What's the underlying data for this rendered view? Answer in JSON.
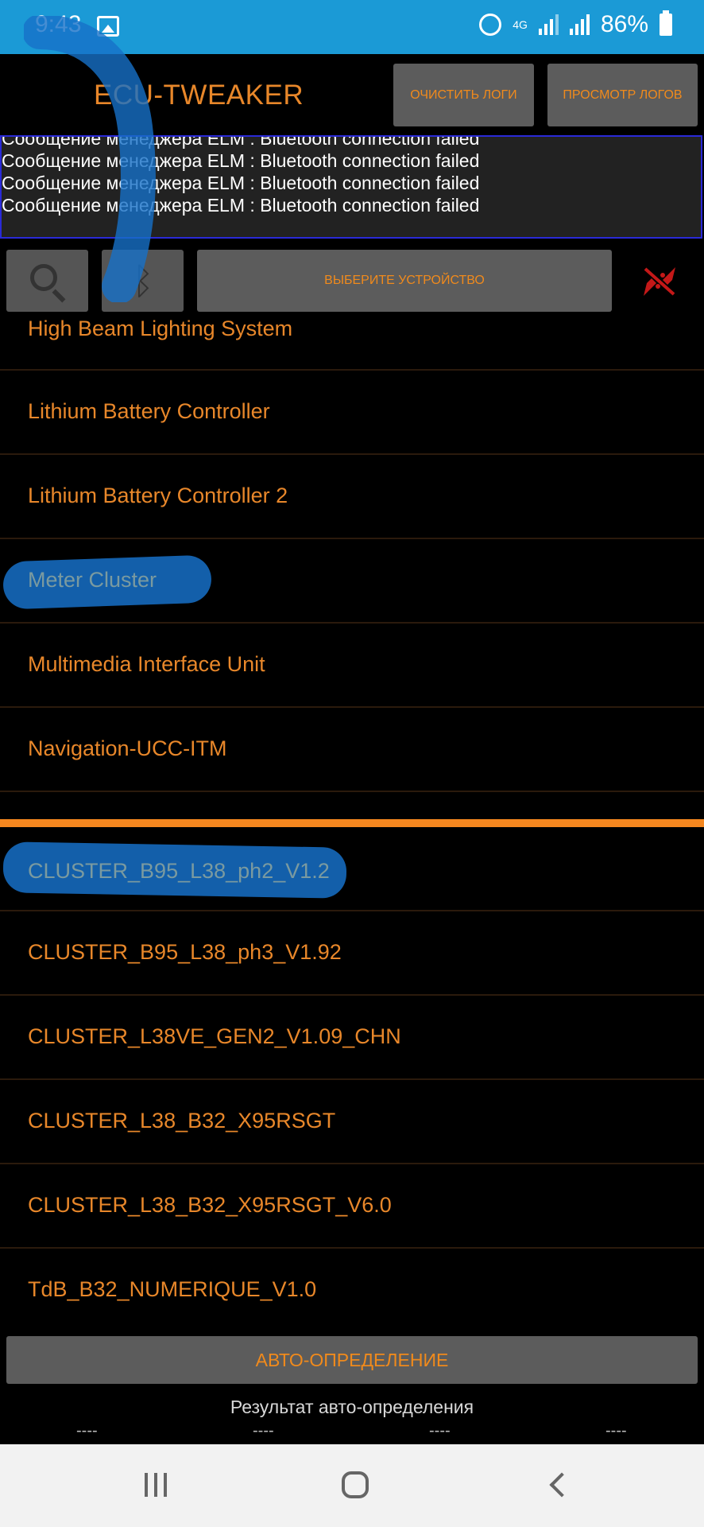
{
  "status_bar": {
    "time": "9:43",
    "network": "4G",
    "battery": "86%"
  },
  "app": {
    "title": "ECU-TWEAKER",
    "clear_logs_label": "ОЧИСТИТЬ ЛОГИ",
    "view_logs_label": "ПРОСМОТР ЛОГОВ"
  },
  "log": {
    "lines": [
      "Сообщение менеджера ELM : Bluetooth connection failed",
      "Сообщение менеджера ELM : Bluetooth connection failed",
      "Сообщение менеджера ELM : Bluetooth connection failed",
      "Сообщение менеджера ELM : Bluetooth connection failed"
    ]
  },
  "toolbar": {
    "select_device_label": "ВЫБЕРИТЕ УСТРОЙСТВО"
  },
  "ecu_list": {
    "items": [
      "High Beam Lighting System",
      "Lithium Battery Controller",
      "Lithium Battery Controller 2",
      "Meter Cluster",
      "Multimedia Interface Unit",
      "Navigation-UCC-ITM"
    ]
  },
  "firmware_list": {
    "items": [
      "CLUSTER_B95_L38_ph2_V1.2",
      "CLUSTER_B95_L38_ph3_V1.92",
      "CLUSTER_L38VE_GEN2_V1.09_CHN",
      "CLUSTER_L38_B32_X95RSGT",
      "CLUSTER_L38_B32_X95RSGT_V6.0",
      "TdB_B32_NUMERIQUE_V1.0"
    ]
  },
  "auto_detect": {
    "button_label": "АВТО-ОПРЕДЕЛЕНИЕ",
    "result_label": "Результат авто-определения",
    "placeholders": [
      "----",
      "----",
      "----",
      "----"
    ]
  },
  "colors": {
    "accent": "#e8872a",
    "status_bar": "#1b9ad6",
    "separator": "#f5871f",
    "marker": "#1670c8"
  }
}
